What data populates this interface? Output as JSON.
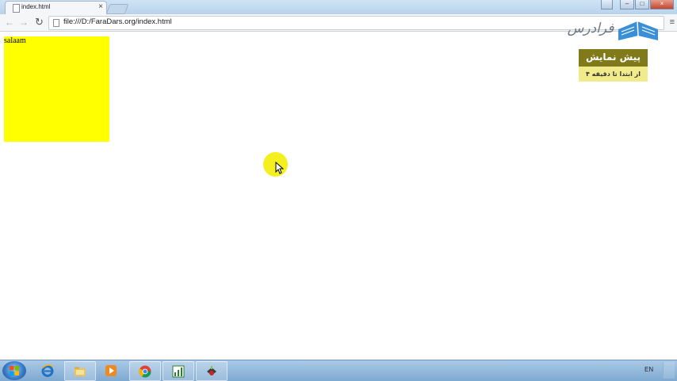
{
  "browser": {
    "tab_title": "index.html",
    "tab_close": "×",
    "address": "file:///D:/FaraDars.org/index.html",
    "nav_back": "←",
    "nav_forward": "→",
    "reload": "↻",
    "menu": "≡",
    "window_controls": {
      "minimize": "–",
      "maximize": "□",
      "close": "×"
    }
  },
  "page": {
    "box_text": "salaam",
    "box_color": "#ffff00"
  },
  "overlay": {
    "logo_text": "فرادرس",
    "preview_title": "پیش نمایش",
    "preview_subtitle": "از ابتدا تا دقیقه ۴"
  },
  "taskbar": {
    "items": [
      "start-icon",
      "internet-explorer-icon",
      "windows-explorer-icon",
      "media-player-icon",
      "chrome-icon",
      "chart-app-icon",
      "tool-icon"
    ],
    "language": "EN"
  }
}
